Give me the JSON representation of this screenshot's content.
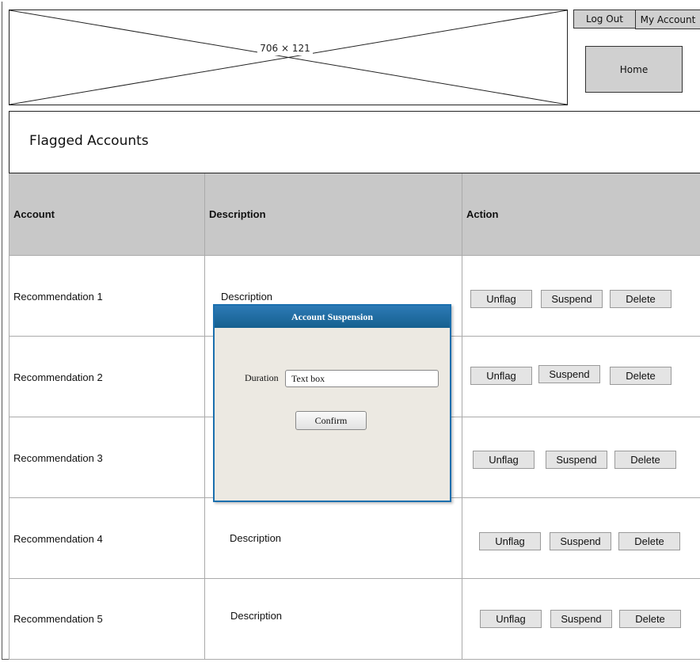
{
  "header": {
    "banner_label": "706 × 121",
    "logout_label": "Log Out",
    "my_account_label": "My Account",
    "home_label": "Home"
  },
  "page": {
    "title": "Flagged Accounts"
  },
  "table": {
    "columns": [
      "Account",
      "Description",
      "Action"
    ],
    "rows": [
      {
        "account": "Recommendation 1",
        "description": "Description"
      },
      {
        "account": "Recommendation 2",
        "description": ""
      },
      {
        "account": "Recommendation 3",
        "description": ""
      },
      {
        "account": "Recommendation 4",
        "description": "Description"
      },
      {
        "account": "Recommendation 5",
        "description": "Description"
      }
    ],
    "actions": {
      "unflag": "Unflag",
      "suspend": "Suspend",
      "delete": "Delete"
    }
  },
  "modal": {
    "title": "Account Suspension",
    "duration_label": "Duration",
    "duration_value": "Text box",
    "confirm_label": "Confirm"
  },
  "colors": {
    "header_bg": "#c8c8c8",
    "modal_header": "#1b6fae",
    "modal_bg": "#ece9e2",
    "button_bg": "#e4e4e4"
  }
}
